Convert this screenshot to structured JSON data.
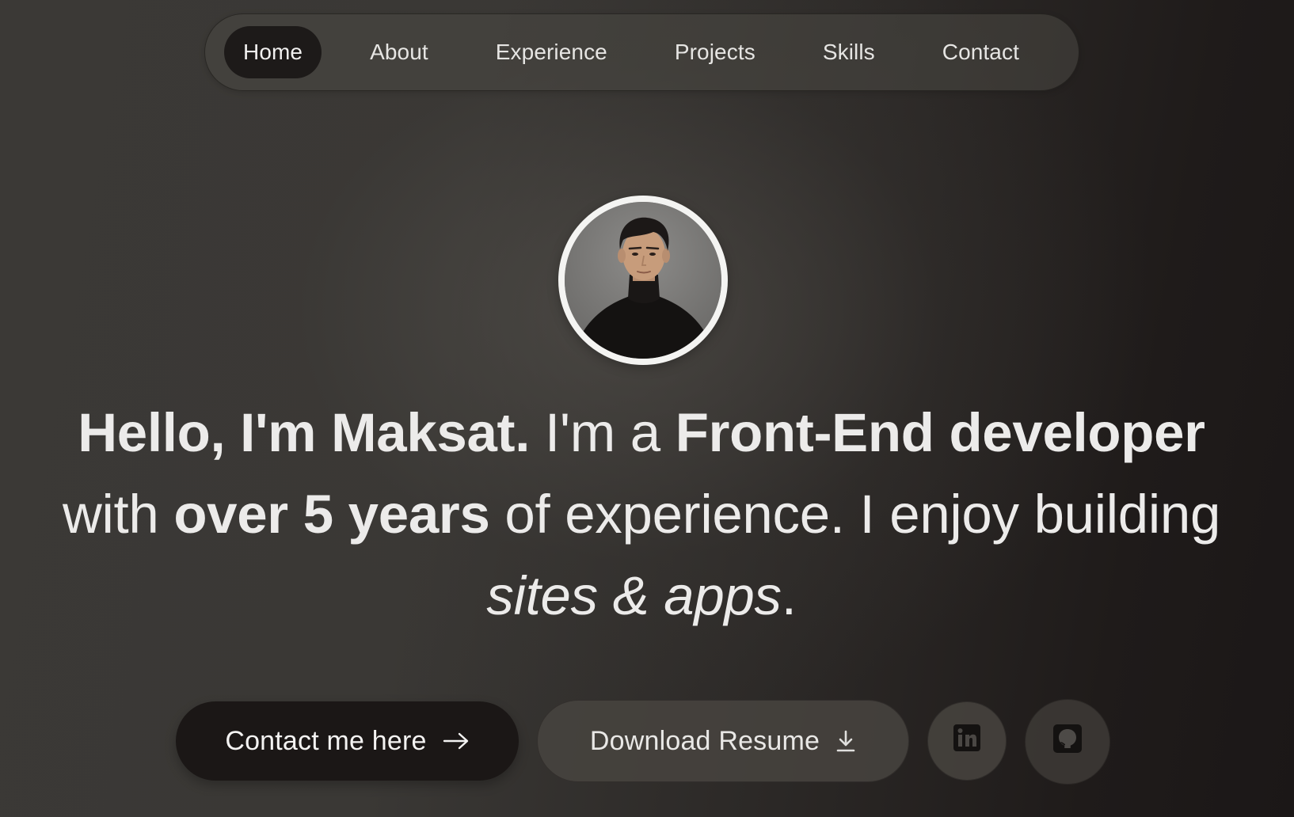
{
  "nav": {
    "items": [
      {
        "label": "Home",
        "active": true
      },
      {
        "label": "About"
      },
      {
        "label": "Experience"
      },
      {
        "label": "Projects"
      },
      {
        "label": "Skills"
      },
      {
        "label": "Contact"
      }
    ]
  },
  "hero": {
    "avatar_alt": "Maksat profile photo",
    "headline": {
      "p1": "Hello, I'm Maksat.",
      "p2": " I'm a ",
      "p3": "Front-End developer",
      "p4": " with ",
      "p5": "over 5 years",
      "p6": " of experience. I enjoy building ",
      "p7": "sites & apps",
      "p8": "."
    }
  },
  "actions": {
    "contact_label": "Contact me here",
    "contact_icon": "arrow-right-icon",
    "resume_label": "Download Resume",
    "resume_icon": "download-icon",
    "linkedin_icon": "linkedin-icon",
    "github_icon": "github-icon"
  },
  "colors": {
    "accent_dark": "#1b1716",
    "text": "#ecebea",
    "avatar_border": "#f4f4f2"
  }
}
